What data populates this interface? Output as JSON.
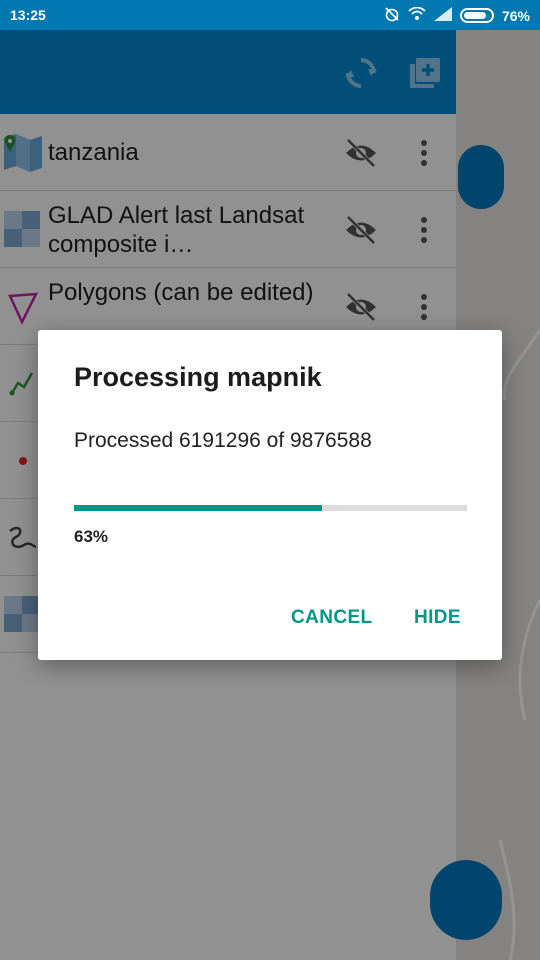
{
  "status_bar": {
    "time": "13:25",
    "battery_percent": "76%",
    "icons": [
      "alarm-off-icon",
      "wifi-icon",
      "signal-icon",
      "battery-icon"
    ]
  },
  "drawer": {
    "header_icons": [
      "sync-icon",
      "add-layer-icon"
    ],
    "layers": [
      {
        "name": "tanzania",
        "icon": "map-pin-icon"
      },
      {
        "name": "GLAD Alert last Landsat composite i…",
        "icon": "raster-grid-icon"
      },
      {
        "name": "Polygons (can be edited)",
        "icon": "polygon-icon"
      },
      {
        "name": "",
        "icon": "line-icon"
      },
      {
        "name": "",
        "icon": "point-icon"
      },
      {
        "name": "",
        "icon": "track-icon"
      },
      {
        "name": "",
        "icon": "raster-grid-icon"
      }
    ]
  },
  "dialog": {
    "title": "Processing mapnik",
    "message": "Processed 6191296 of 9876588",
    "progress_value": 0.63,
    "progress_label": "63%",
    "cancel_label": "CANCEL",
    "hide_label": "HIDE"
  },
  "colors": {
    "status_bar": "#0278b0",
    "toolbar": "#0288d1",
    "accent": "#009688",
    "fab": "#0277bd"
  }
}
